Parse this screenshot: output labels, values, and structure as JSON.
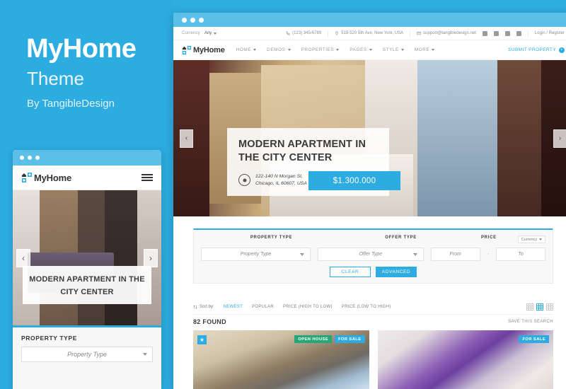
{
  "promo": {
    "title": "MyHome",
    "subtitle": "Theme",
    "author": "By TangibleDesign"
  },
  "brand": {
    "accent": "#2cace0",
    "chrome": "#5bc0e8",
    "green": "#27a776",
    "logo_text": "MyHome",
    "logo_icon": "house-logo-icon"
  },
  "topbar": {
    "currency_label": "Currency",
    "currency_value": "Any",
    "phone": "(123) 345-6789",
    "address": "518-520 5th Ave, New York, USA",
    "email": "support@tangibledesign.net",
    "account": "Login / Register",
    "socials": [
      "facebook-icon",
      "twitter-icon",
      "instagram-icon",
      "linkedin-icon"
    ]
  },
  "nav": {
    "items": [
      {
        "label": "HOME",
        "has_dropdown": true
      },
      {
        "label": "DEMOS",
        "has_dropdown": true
      },
      {
        "label": "PROPERTIES",
        "has_dropdown": true
      },
      {
        "label": "PAGES",
        "has_dropdown": true
      },
      {
        "label": "STYLE",
        "has_dropdown": true
      },
      {
        "label": "MORE",
        "has_dropdown": true
      }
    ],
    "submit_property": "SUBMIT PROPERTY"
  },
  "hero": {
    "title": "MODERN APARTMENT IN THE CITY CENTER",
    "address_line1": "122-140 N Morgan St,",
    "address_line2": "Chicago, IL 60607, USA",
    "price": "$1.300.000",
    "prev_icon": "chevron-left-icon",
    "next_icon": "chevron-right-icon"
  },
  "search": {
    "labels": {
      "property_type": "PROPERTY TYPE",
      "offer_type": "OFFER TYPE",
      "price": "PRICE"
    },
    "property_type_value": "Property Type",
    "offer_type_value": "Offer Type",
    "price_from": "From",
    "price_dash": "-",
    "price_to": "To",
    "currency_value": "Currency",
    "clear_label": "CLEAR",
    "advanced_label": "ADVANCED"
  },
  "sort": {
    "label": "Sort by:",
    "options": [
      {
        "label": "NEWEST",
        "active": true
      },
      {
        "label": "POPULAR",
        "active": false
      },
      {
        "label": "PRICE (HIGH TO LOW)",
        "active": false
      },
      {
        "label": "PRICE (LOW TO HIGH)",
        "active": false
      }
    ],
    "view_modes": [
      "grid-small-icon",
      "grid-large-icon",
      "list-icon"
    ],
    "active_view_index": 1
  },
  "results": {
    "found": "82 FOUND",
    "save_search": "SAVE THIS SEARCH",
    "cards": [
      {
        "featured": true,
        "featured_icon": "star-icon",
        "badges": [
          {
            "label": "OPEN HOUSE",
            "color": "#27a776"
          },
          {
            "label": "FOR SALE",
            "color": "#2cace0"
          }
        ]
      },
      {
        "featured": false,
        "badges": [
          {
            "label": "FOR SALE",
            "color": "#2cace0"
          }
        ]
      }
    ]
  },
  "mobile": {
    "logo_text": "MyHome",
    "menu_icon": "hamburger-icon",
    "caption": "MODERN APARTMENT IN THE CITY CENTER",
    "field_label": "PROPERTY TYPE",
    "field_value": "Property Type",
    "prev_icon": "chevron-left-icon",
    "next_icon": "chevron-right-icon"
  }
}
